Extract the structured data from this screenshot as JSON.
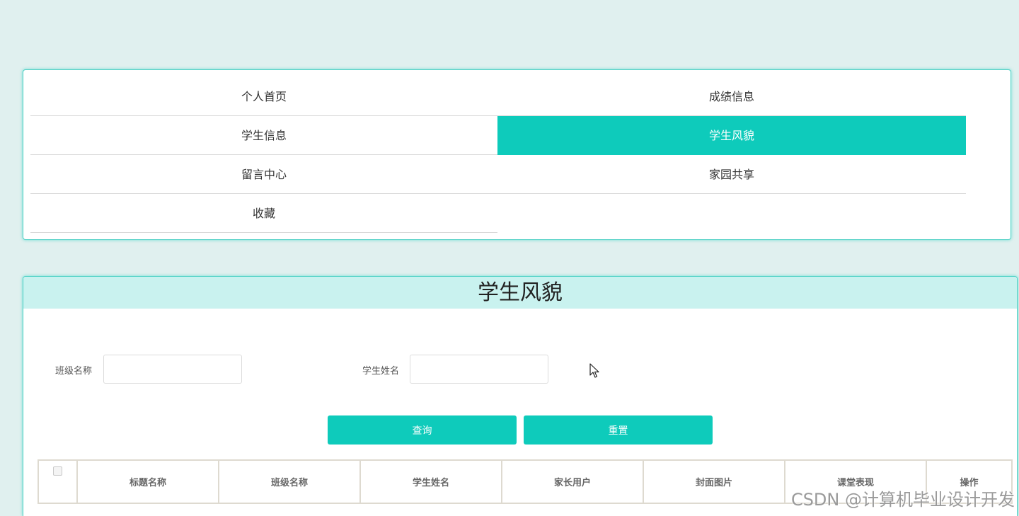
{
  "nav": {
    "items": [
      {
        "label": "个人首页",
        "active": false
      },
      {
        "label": "成绩信息",
        "active": false
      },
      {
        "label": "学生信息",
        "active": false
      },
      {
        "label": "学生风貌",
        "active": true
      },
      {
        "label": "留言中心",
        "active": false
      },
      {
        "label": "家园共享",
        "active": false
      },
      {
        "label": "收藏",
        "active": false
      }
    ]
  },
  "page": {
    "title": "学生风貌"
  },
  "search": {
    "class_name_label": "班级名称",
    "class_name_value": "",
    "student_name_label": "学生姓名",
    "student_name_value": "",
    "query_button": "查询",
    "reset_button": "重置"
  },
  "table": {
    "columns": [
      "标题名称",
      "班级名称",
      "学生姓名",
      "家长用户",
      "封面图片",
      "课堂表现",
      "操作"
    ]
  },
  "watermark": "CSDN @计算机毕业设计开发",
  "colors": {
    "accent": "#0ecbbb",
    "background": "#e0f0ef",
    "header_bg": "#c9f2ef"
  }
}
